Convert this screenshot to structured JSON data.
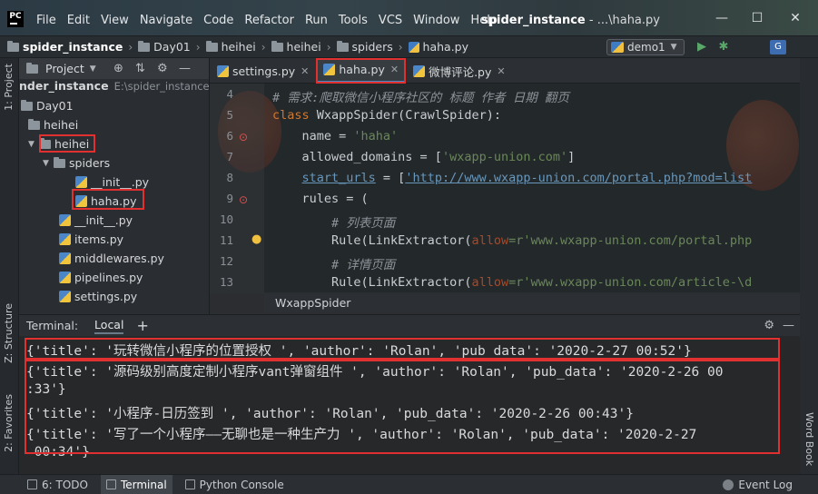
{
  "titlebar": {
    "logo": "PC",
    "menu": [
      "File",
      "Edit",
      "View",
      "Navigate",
      "Code",
      "Refactor",
      "Run",
      "Tools",
      "VCS",
      "Window",
      "Help"
    ],
    "project_name": "spider_instance",
    "window_path": " - ...\\haha.py",
    "buttons": {
      "minimize": "—",
      "maximize": "☐",
      "close": "✕"
    }
  },
  "navbar": {
    "crumbs": [
      "spider_instance",
      "Day01",
      "heihei",
      "heihei",
      "spiders",
      "haha.py"
    ],
    "run_config": "demo1",
    "icons": [
      "run-icon",
      "debug-icon",
      "translate-icon"
    ]
  },
  "stripes": {
    "project_tab": "1: Project",
    "structure_tab": "Z: Structure",
    "favorites_tab": "2: Favorites",
    "wordbook_tab": "Word Book"
  },
  "project_panel": {
    "title": "Project",
    "root_label": "nder_instance",
    "root_path": "E:\\spider_instance",
    "items": [
      {
        "label": "Day01",
        "kind": "folder"
      },
      {
        "label": "heihei",
        "kind": "folder"
      },
      {
        "label": "heihei",
        "kind": "folder"
      },
      {
        "label": "spiders",
        "kind": "folder"
      },
      {
        "label": "__init__.py",
        "kind": "py"
      },
      {
        "label": "haha.py",
        "kind": "py"
      },
      {
        "label": "__init__.py",
        "kind": "py"
      },
      {
        "label": "items.py",
        "kind": "py"
      },
      {
        "label": "middlewares.py",
        "kind": "py"
      },
      {
        "label": "pipelines.py",
        "kind": "py"
      },
      {
        "label": "settings.py",
        "kind": "py"
      }
    ]
  },
  "editor": {
    "tabs": [
      {
        "label": "settings.py"
      },
      {
        "label": "haha.py"
      },
      {
        "label": "微博评论.py"
      }
    ],
    "line_numbers": [
      "4",
      "5",
      "6",
      "7",
      "8",
      "9",
      "10",
      "11",
      "12",
      "13"
    ],
    "code": {
      "l4": "# 需求:爬取微信小程序社区的 标题 作者 日期 翻页",
      "l5_kw": "class",
      "l5_rest": " WxappSpider(CrawlSpider):",
      "l6_a": "    name = ",
      "l6_b": "'haha'",
      "l7_a": "    allowed_domains = [",
      "l7_b": "'wxapp-union.com'",
      "l7_c": "]",
      "l8_a": "    ",
      "l8_b": "start_urls",
      "l8_c": " = [",
      "l8_d": "'http://www.wxapp-union.com/portal.php?mod=list",
      "l9": "    rules = (",
      "l10": "        # 列表页面",
      "l11_a": "        Rule(LinkExtractor(",
      "l11_b": "allow",
      "l11_c": "=r'www.wxapp-union.com/portal.php",
      "l12": "        # 详情页面",
      "l13_a": "        Rule(LinkExtractor(",
      "l13_b": "allow",
      "l13_c": "=r'www.wxapp-union.com/article-\\d"
    },
    "breadcrumb": "WxappSpider"
  },
  "terminal": {
    "label": "Terminal:",
    "tab": "Local",
    "add": "+",
    "lines": [
      "{'title': '玩转微信小程序的位置授权 ', 'author': 'Rolan', 'pub_data': '2020-2-27 00:52'}",
      "{'title': '源码级别高度定制小程序vant弹窗组件 ', 'author': 'Rolan', 'pub_data': '2020-2-26 00",
      ":33'}",
      "{'title': '小程序-日历签到 ', 'author': 'Rolan', 'pub_data': '2020-2-26 00:43'}",
      "{'title': '写了一个小程序——无聊也是一种生产力 ', 'author': 'Rolan', 'pub_data': '2020-2-27",
      " 00:34'}"
    ]
  },
  "bottom_bar": {
    "tabs": [
      {
        "label": "6: TODO"
      },
      {
        "label": "Terminal"
      },
      {
        "label": "Python Console"
      }
    ],
    "event_log": "Event Log"
  },
  "colors": {
    "keyword": "#cc7832",
    "string": "#6a8759",
    "highlight": "#e03030",
    "active_tab": "#4a88c7"
  }
}
